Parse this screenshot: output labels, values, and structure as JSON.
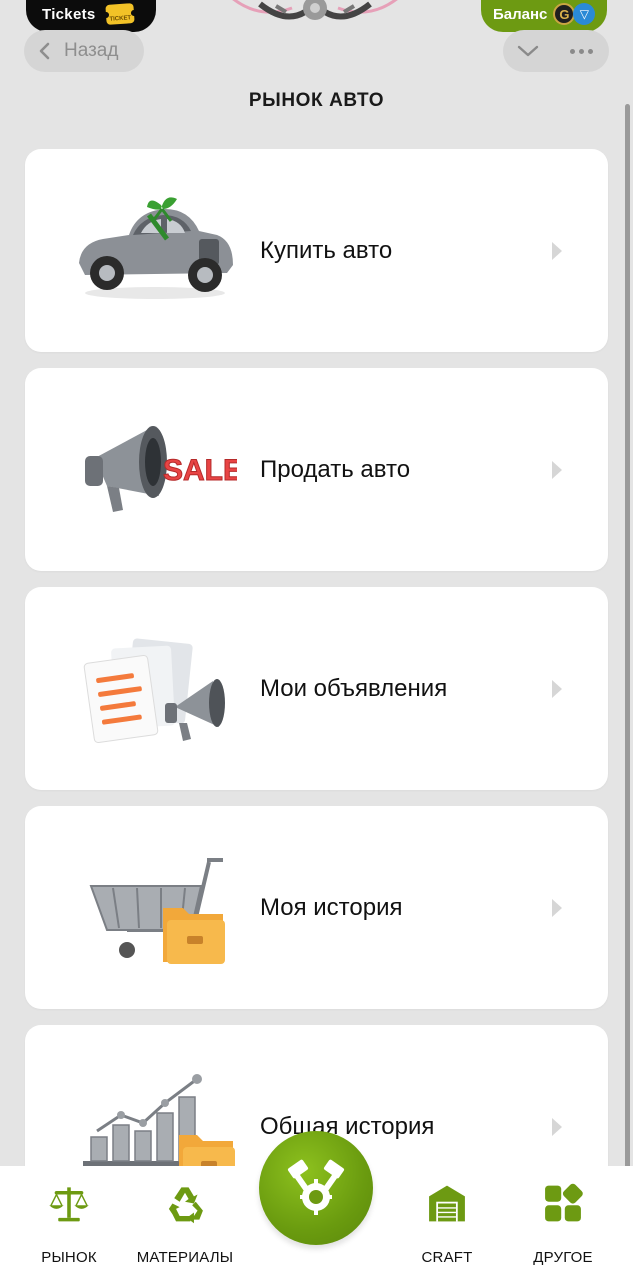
{
  "header": {
    "tickets_label": "Tickets",
    "ticket_badge": "TICKET",
    "balance_label": "Баланс",
    "balance_coin": "G",
    "back_label": "Назад",
    "page_title": "РЫНОК АВТО"
  },
  "menu": [
    {
      "label": "Купить авто",
      "icon": "vintage-car-gift-icon"
    },
    {
      "label": "Продать авто",
      "icon": "megaphone-sale-icon"
    },
    {
      "label": "Мои объявления",
      "icon": "documents-megaphone-icon"
    },
    {
      "label": "Моя история",
      "icon": "cart-folder-icon"
    },
    {
      "label": "Общая история",
      "icon": "chart-folder-icon"
    }
  ],
  "sale_text": "SALE",
  "tabs": [
    {
      "label": "РЫНОК",
      "icon": "scales-icon"
    },
    {
      "label": "МАТЕРИАЛЫ",
      "icon": "recycle-icon"
    },
    {
      "label": "",
      "icon": "engine-icon"
    },
    {
      "label": "CRAFT",
      "icon": "warehouse-icon"
    },
    {
      "label": "ДРУГОЕ",
      "icon": "apps-grid-icon"
    }
  ],
  "colors": {
    "accent_green": "#6d9a12",
    "background": "#e4e4e4",
    "card": "#ffffff"
  }
}
